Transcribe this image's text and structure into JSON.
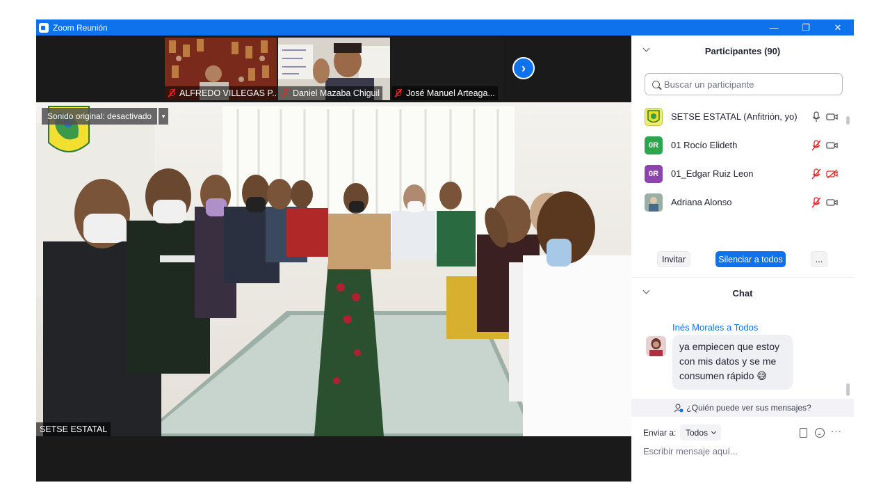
{
  "window": {
    "title": "Zoom Reunión",
    "controls": [
      "minimize-icon",
      "restore-icon",
      "close-icon"
    ]
  },
  "thumbnails": [
    {
      "name": "ALFREDO VILLEGAS P...",
      "muted": true
    },
    {
      "name": "Daniel Mazaba Chiguil",
      "muted": true
    },
    {
      "name": "José Manuel Arteaga...",
      "muted": true
    }
  ],
  "main_video": {
    "original_sound_label": "Sonido original: desactivado",
    "speaker_name": "SETSE ESTATAL"
  },
  "participants": {
    "header": "Participantes (90)",
    "search_placeholder": "Buscar un participante",
    "items": [
      {
        "name": "SETSE ESTATAL (Anfitrión, yo)",
        "avatar_text": "",
        "avatar_color": "#d8d820",
        "mic": "on",
        "cam": "on"
      },
      {
        "name": "01 Rocío Elideth",
        "avatar_text": "0R",
        "avatar_color": "#2da44e",
        "mic": "muted",
        "cam": "on"
      },
      {
        "name": "01_Edgar Ruiz Leon",
        "avatar_text": "0R",
        "avatar_color": "#8e44ad",
        "mic": "muted",
        "cam": "off"
      },
      {
        "name": "Adriana Alonso",
        "avatar_text": "",
        "avatar_color": "#7a9a8a",
        "mic": "muted",
        "cam": "on"
      }
    ],
    "buttons": {
      "invite": "Invitar",
      "mute_all": "Silenciar a todos",
      "more": "..."
    }
  },
  "chat": {
    "header": "Chat",
    "messages": [
      {
        "sender": "Inés Morales",
        "to_label": "a Todos",
        "text": "ya empiecen que estoy con mis datos y se me consumen rápido 😅"
      }
    ],
    "who_can_see": "¿Quién puede ver sus mensajes?",
    "send_to_label": "Enviar a:",
    "send_to_value": "Todos",
    "input_placeholder": "Escribir mensaje aquí..."
  },
  "colors": {
    "zoom_blue": "#0e72ed",
    "muted_red": "#e02828"
  }
}
